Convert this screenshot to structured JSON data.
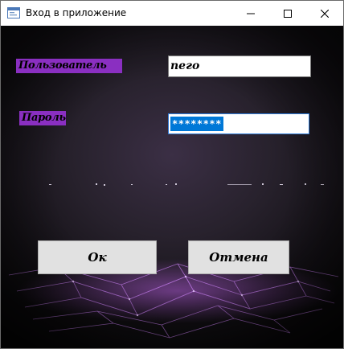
{
  "window": {
    "title": "Вход в приложение"
  },
  "form": {
    "user_label": "Пользователь",
    "user_value": "пего",
    "password_label": "Пароль",
    "password_masked": "********"
  },
  "buttons": {
    "ok": "Ок",
    "cancel": "Отмена"
  },
  "colors": {
    "label_bg": "#8a2fc1",
    "selection": "#0078d7",
    "button_bg": "#e1e1e1"
  }
}
